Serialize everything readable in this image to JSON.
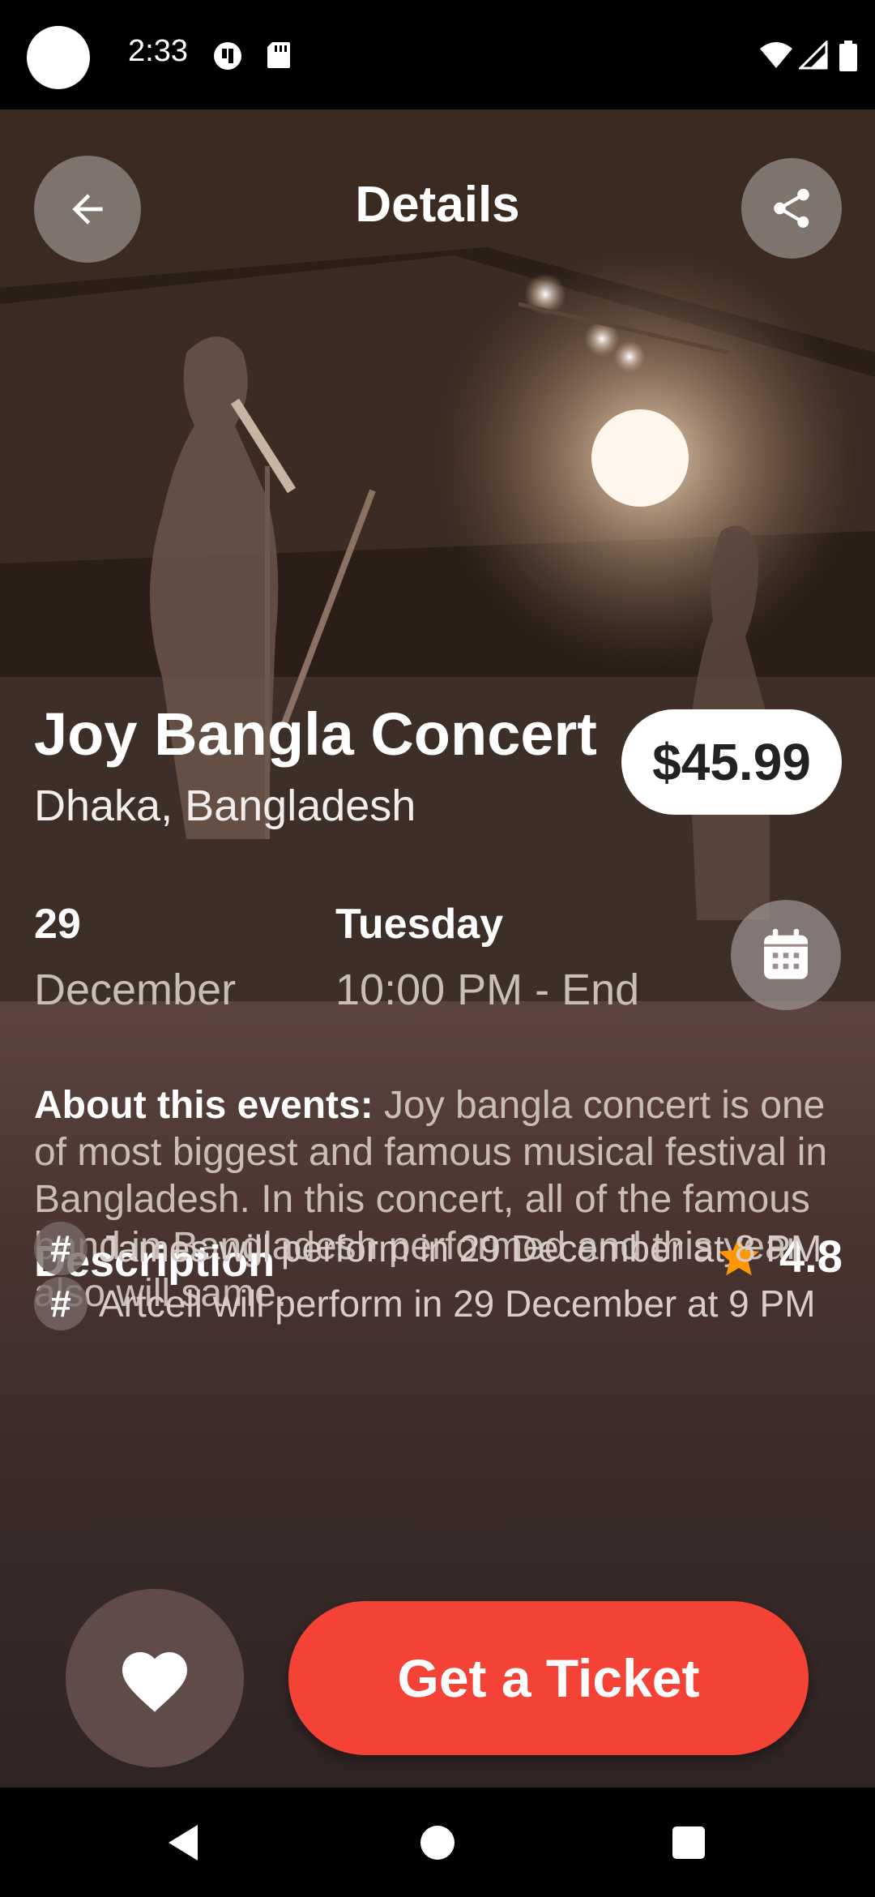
{
  "status_bar": {
    "time": "2:33"
  },
  "header": {
    "title": "Details"
  },
  "event": {
    "title": "Joy Bangla Concert",
    "location": "Dhaka, Bangladesh",
    "price": "$45.99",
    "day": "29",
    "month": "December",
    "weekday": "Tuesday",
    "time_range": "10:00 PM - End"
  },
  "about": {
    "label": "About this events:",
    "text": " Joy bangla concert is one of most biggest and famous musical festival in Bangladesh. In this concert, all of the famous band in Bangladesh performed and this year also will same."
  },
  "description": {
    "heading": "Description",
    "rating": "4.8",
    "items": [
      {
        "symbol": "#",
        "text": "James will perform in 29 December at 8 PM"
      },
      {
        "symbol": "#",
        "text": "Artcell will perform in 29 December at 9 PM"
      }
    ]
  },
  "actions": {
    "cta_label": "Get a Ticket"
  },
  "colors": {
    "accent": "#f44336",
    "star": "#ff9800",
    "surface": "#5f4c48"
  },
  "icons": [
    "back-arrow-icon",
    "share-icon",
    "calendar-icon",
    "star-icon",
    "heart-icon",
    "nav-back-icon",
    "nav-home-icon",
    "nav-recents-icon"
  ]
}
